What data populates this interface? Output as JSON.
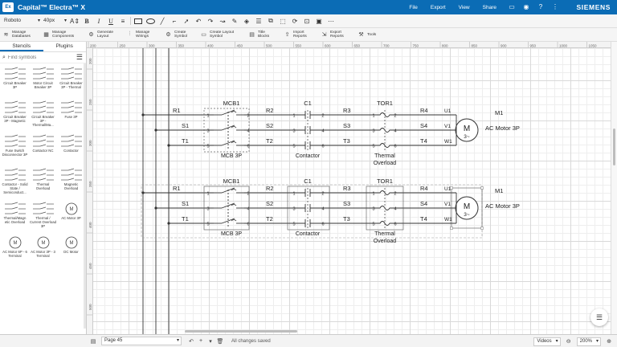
{
  "titlebar": {
    "app_title": "Capital™ Electra™ X",
    "logo_text": "Ex",
    "menu": [
      "File",
      "Export",
      "View",
      "Share"
    ],
    "brand": "SIEMENS"
  },
  "format_toolbar": {
    "font": "Roboto",
    "font_size": "40px",
    "text_size_icon": "A⇕",
    "bold": "B",
    "italic": "I",
    "underline": "U"
  },
  "ribbon": [
    {
      "icon": "database-icon",
      "glyph": "≋",
      "label": "Manage Databases"
    },
    {
      "icon": "components-icon",
      "glyph": "▦",
      "label": "Manage Components"
    },
    {
      "icon": "layout-icon",
      "glyph": "⚙",
      "label": "Generate Layout"
    },
    {
      "icon": "wirings-icon",
      "glyph": "⫶",
      "label": "Manage Wirings"
    },
    {
      "icon": "symbol-icon",
      "glyph": "⚙",
      "label": "Create Symbol"
    },
    {
      "icon": "layout-symbol-icon",
      "glyph": "▭",
      "label": "Create Layout Symbol"
    },
    {
      "icon": "title-blocks-icon",
      "glyph": "▤",
      "label": "Title Blocks"
    },
    {
      "icon": "import-icon",
      "glyph": "⇪",
      "label": "Import Reports"
    },
    {
      "icon": "export-icon",
      "glyph": "⇲",
      "label": "Export Reports"
    },
    {
      "icon": "tools-icon",
      "glyph": "⚒",
      "label": "Tools"
    }
  ],
  "left_panel": {
    "tabs": [
      "Stencils",
      "Plugins"
    ],
    "search_placeholder": "Find symbols",
    "stencils": [
      "Circuit Breaker 3P",
      "Motor Circuit Breaker 3P",
      "Circuit Breaker 3P - Thermal",
      "Circuit Breaker 3P - Magnetic",
      "Circuit Breaker 3P - Thermal/Ma...",
      "Fuse 3P",
      "Fuse Switch Disconnector 3P",
      "Contactor NC",
      "Contactor",
      "Contactor - Solid State / Semiconduct...",
      "Thermal Overload",
      "Magnetic Overload",
      "Thermal/Magn etic Overload",
      "Thermal / Current Overload 3P",
      "AC Motor 3P",
      "AC Motor 6P - 6 Terminal",
      "AC Motor 3P - 3 Terminal",
      "DC Motor"
    ]
  },
  "ruler": {
    "top_ticks": [
      "200",
      "250",
      "300",
      "350",
      "400",
      "450",
      "500",
      "550",
      "600",
      "650",
      "700",
      "750",
      "800",
      "850",
      "900",
      "950",
      "1000",
      "1050"
    ],
    "left_ticks": [
      "200",
      "250",
      "300",
      "350",
      "400",
      "450",
      "500"
    ]
  },
  "schematic": {
    "circuits": [
      {
        "lines_in": [
          "R1",
          "S1",
          "T1"
        ],
        "breaker_ref": "MCB1",
        "breaker_name": "MCB 3P",
        "breaker_terms_in": [
          "1",
          "3",
          "5"
        ],
        "breaker_terms_out": [
          "2",
          "4",
          "6"
        ],
        "mid1": [
          "R2",
          "S2",
          "T2"
        ],
        "contactor_ref": "C1",
        "contactor_name": "Contactor",
        "contactor_terms_in": [
          "1",
          "3",
          "5"
        ],
        "contactor_terms_out": [
          "2",
          "4",
          "6"
        ],
        "mid2": [
          "R3",
          "S3",
          "T3"
        ],
        "overload_ref": "TOR1",
        "overload_name_1": "Thermal",
        "overload_name_2": "Overload",
        "mid3": [
          "R4",
          "S4",
          "T4"
        ],
        "motor_terms": [
          "U1",
          "V1",
          "W1"
        ],
        "motor_ref": "M1",
        "motor_name": "AC Motor 3P",
        "motor_symbol": "M",
        "motor_phase": "3~"
      },
      {
        "lines_in": [
          "R1",
          "S1",
          "T1"
        ],
        "breaker_ref": "MCB1",
        "breaker_name": "MCB 3P",
        "breaker_terms_in": [
          "1",
          "3",
          "5"
        ],
        "breaker_terms_out": [
          "2",
          "4",
          "6"
        ],
        "mid1": [
          "R2",
          "S2",
          "T2"
        ],
        "contactor_ref": "C1",
        "contactor_name": "Contactor",
        "contactor_terms_in": [
          "1",
          "3",
          "5"
        ],
        "contactor_terms_out": [
          "2",
          "4",
          "6"
        ],
        "mid2": [
          "R3",
          "S3",
          "T3"
        ],
        "overload_ref": "TOR1",
        "overload_name_1": "Thermal",
        "overload_name_2": "Overload",
        "mid3": [
          "R4",
          "S4",
          "T4"
        ],
        "motor_terms": [
          "U1",
          "V1",
          "W1"
        ],
        "motor_ref": "M1",
        "motor_name": "AC Motor 3P",
        "motor_symbol": "M",
        "motor_phase": "3~"
      }
    ]
  },
  "bottombar": {
    "page": "Page 45",
    "status": "All changes saved",
    "layer": "Videos",
    "zoom": "200%"
  }
}
